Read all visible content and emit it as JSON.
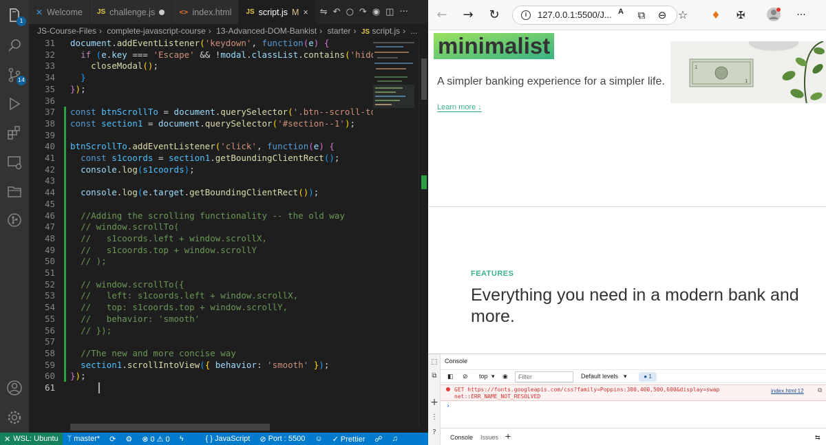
{
  "vscode": {
    "tabs": [
      {
        "label": "Welcome",
        "icon": "vscode-logo-icon"
      },
      {
        "label": "challenge.js",
        "icon": "js-file-icon",
        "prefix": "JS",
        "dirty": true
      },
      {
        "label": "index.html",
        "icon": "html-file-icon",
        "prefix": "<>"
      },
      {
        "label": "script.js",
        "icon": "js-file-icon",
        "prefix": "JS",
        "status": "M",
        "active": true
      }
    ],
    "breadcrumb": [
      "JS-Course-Files",
      "complete-javascript-course",
      "13-Advanced-DOM-Bankist",
      "starter",
      "script.js",
      "..."
    ],
    "breadcrumb_js": "JS",
    "badges": {
      "explorer": "1",
      "source_control": "14"
    },
    "line_numbers": [
      "31",
      "32",
      "33",
      "34",
      "35",
      "36",
      "37",
      "38",
      "39",
      "40",
      "41",
      "42",
      "43",
      "44",
      "45",
      "46",
      "47",
      "48",
      "49",
      "50",
      "51",
      "52",
      "53",
      "54",
      "55",
      "56",
      "57",
      "58",
      "59",
      "60",
      "61"
    ],
    "status": {
      "remote": "WSL: Ubuntu",
      "branch": "master*",
      "problems": "0 ⚠ 0",
      "language": "{ } JavaScript",
      "port": "Port : 5500",
      "prettier": "✓ Prettier"
    }
  },
  "browser": {
    "url": "127.0.0.1:5500/J...",
    "menu": "···",
    "page": {
      "hero_title": "minimalist",
      "hero_subtitle": "A simpler banking experience for a simpler life.",
      "learn_more": "Learn more ↓",
      "features_label": "FEATURES",
      "features_heading": "Everything you need in a modern bank and more."
    },
    "devtools": {
      "title": "Console",
      "context": "top",
      "filter_placeholder": "Filter",
      "levels": "Default levels",
      "message_count": "1",
      "error_line1": "GET https://fonts.googleapis.com/css?family=Poppins:300,400,500,600&display=swap",
      "error_line2": "net::ERR_NAME_NOT_RESOLVED",
      "error_source": "index.html:12",
      "tabs": [
        "Console",
        "Issues"
      ]
    }
  }
}
